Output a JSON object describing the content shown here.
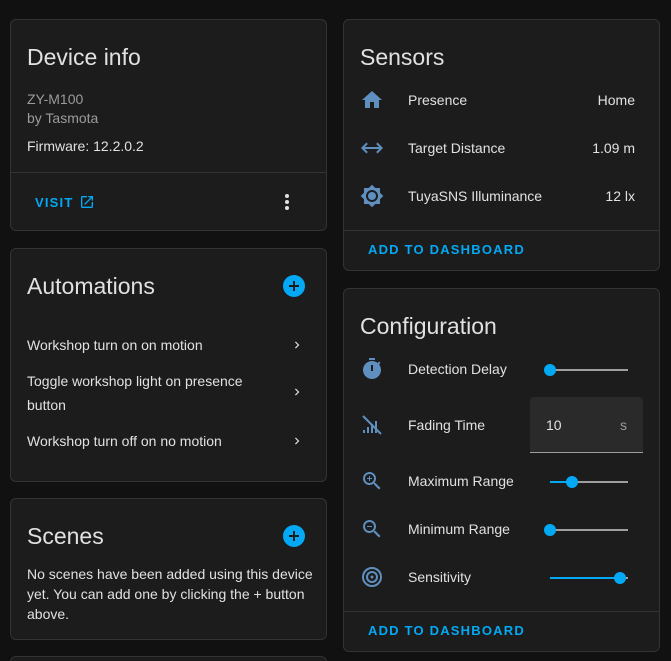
{
  "device_info": {
    "title": "Device info",
    "model": "ZY-M100",
    "manufacturer": "by Tasmota",
    "firmware": "Firmware: 12.2.0.2",
    "visit_label": "VISIT"
  },
  "automations": {
    "title": "Automations",
    "items": [
      {
        "label": "Workshop turn on on motion"
      },
      {
        "label_line1": "Toggle workshop light on presence",
        "label_line2": "button"
      },
      {
        "label": "Workshop turn off on no motion"
      }
    ]
  },
  "scenes": {
    "title": "Scenes",
    "empty_line1": "No scenes have been added using this device",
    "empty_line2": "yet. You can add one by clicking the + button",
    "empty_line3": "above."
  },
  "sensors": {
    "title": "Sensors",
    "items": [
      {
        "icon": "home-icon",
        "name": "Presence",
        "value": "Home"
      },
      {
        "icon": "arrow-left-right-icon",
        "name": "Target Distance",
        "value": "1.09 m"
      },
      {
        "icon": "brightness-icon",
        "name": "TuyaSNS Illuminance",
        "value": "12 lx"
      }
    ],
    "add_label": "ADD TO DASHBOARD"
  },
  "configuration": {
    "title": "Configuration",
    "items": [
      {
        "icon": "timer-icon",
        "name": "Detection Delay",
        "control": "slider",
        "level": 0.0
      },
      {
        "icon": "signal-off-icon",
        "name": "Fading Time",
        "control": "number",
        "value": "10",
        "unit": "s"
      },
      {
        "icon": "magnify-plus-icon",
        "name": "Maximum Range",
        "control": "slider",
        "level": 0.28
      },
      {
        "icon": "magnify-minus-icon",
        "name": "Minimum Range",
        "control": "slider",
        "level": 0.0
      },
      {
        "icon": "target-icon",
        "name": "Sensitivity",
        "control": "slider",
        "level": 0.9
      }
    ],
    "add_label": "ADD TO DASHBOARD"
  },
  "colors": {
    "accent": "#03a9f4",
    "icon": "#5f8fbf",
    "background": "#111111",
    "card": "#1c1c1c"
  }
}
